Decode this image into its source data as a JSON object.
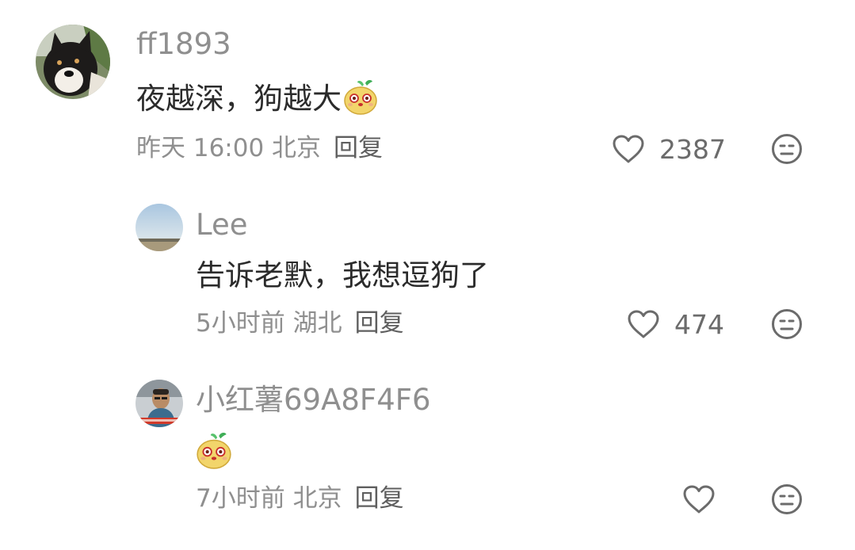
{
  "comments": [
    {
      "username": "ff1893",
      "text": "夜越深，狗越大",
      "emoji": "potato-sticker",
      "time_location": "昨天 16:00 北京",
      "reply_label": "回复",
      "like_count": "2387"
    },
    {
      "username": "Lee",
      "text": "告诉老默，我想逗狗了",
      "time_location": "5小时前 湖北",
      "reply_label": "回复",
      "like_count": "474"
    },
    {
      "username": "小红薯69A8F4F6",
      "text": "",
      "emoji": "potato-sticker",
      "time_location": "7小时前 北京",
      "reply_label": "回复",
      "like_count": ""
    }
  ],
  "colors": {
    "username": "#8f8f8f",
    "content": "#2b2b2b",
    "icon": "#6b6b6b",
    "sticker": "#f2d56b"
  }
}
